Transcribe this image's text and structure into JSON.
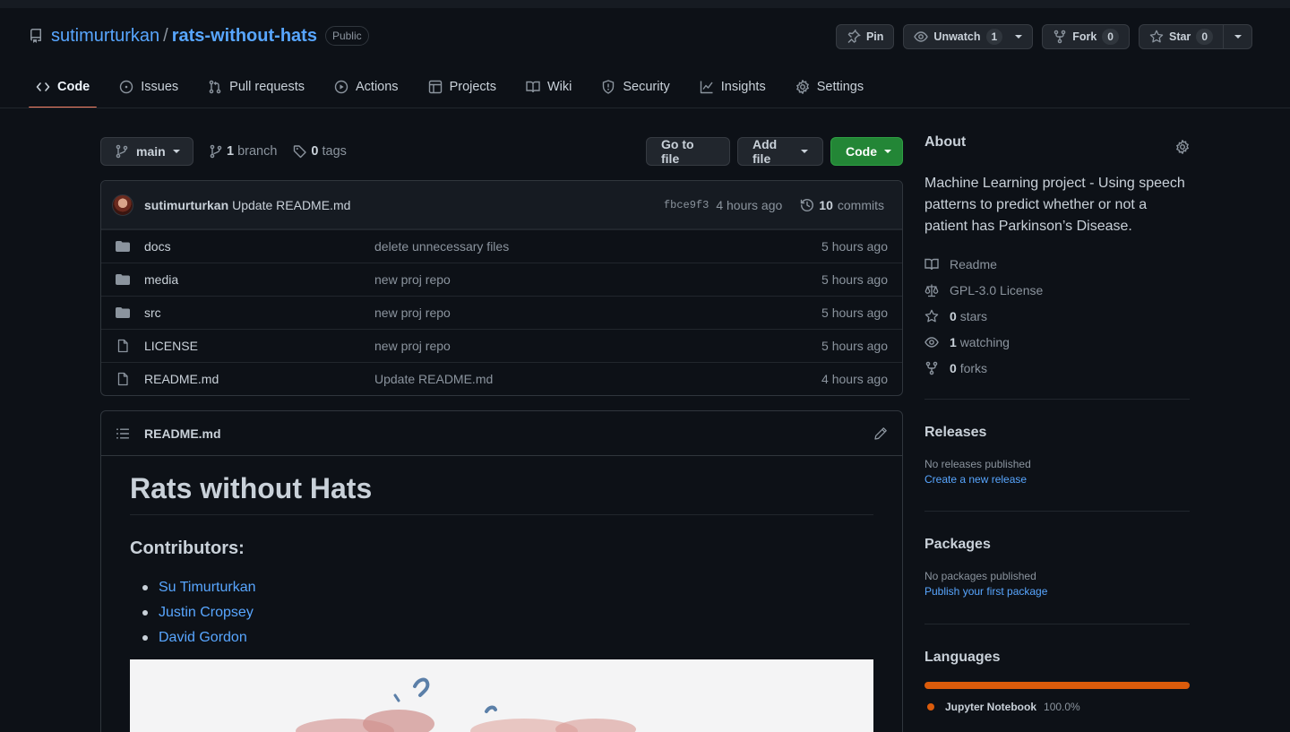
{
  "repo": {
    "owner": "sutimurturkan",
    "separator": "/",
    "name": "rats-without-hats",
    "visibility": "Public"
  },
  "actions": {
    "pin": "Pin",
    "unwatch": "Unwatch",
    "unwatch_count": "1",
    "fork": "Fork",
    "fork_count": "0",
    "star": "Star",
    "star_count": "0"
  },
  "tabs": [
    {
      "label": "Code",
      "icon": "code-icon"
    },
    {
      "label": "Issues",
      "icon": "issue-icon"
    },
    {
      "label": "Pull requests",
      "icon": "pull-request-icon"
    },
    {
      "label": "Actions",
      "icon": "play-icon"
    },
    {
      "label": "Projects",
      "icon": "table-icon"
    },
    {
      "label": "Wiki",
      "icon": "book-icon"
    },
    {
      "label": "Security",
      "icon": "shield-icon"
    },
    {
      "label": "Insights",
      "icon": "graph-icon"
    },
    {
      "label": "Settings",
      "icon": "gear-icon"
    }
  ],
  "toolbar": {
    "branch": "main",
    "branch_count": "1",
    "branch_label": "branch",
    "tag_count": "0",
    "tag_label": "tags",
    "go_to_file": "Go to file",
    "add_file": "Add file",
    "code": "Code"
  },
  "latest_commit": {
    "author": "sutimurturkan",
    "message": "Update README.md",
    "sha": "fbce9f3",
    "age": "4 hours ago",
    "commit_count": "10",
    "commit_label": "commits"
  },
  "files": [
    {
      "type": "folder",
      "name": "docs",
      "message": "delete unnecessary files",
      "age": "5 hours ago"
    },
    {
      "type": "folder",
      "name": "media",
      "message": "new proj repo",
      "age": "5 hours ago"
    },
    {
      "type": "folder",
      "name": "src",
      "message": "new proj repo",
      "age": "5 hours ago"
    },
    {
      "type": "file",
      "name": "LICENSE",
      "message": "new proj repo",
      "age": "5 hours ago"
    },
    {
      "type": "file",
      "name": "README.md",
      "message": "Update README.md",
      "age": "4 hours ago"
    }
  ],
  "readme": {
    "filename": "README.md",
    "title": "Rats without Hats",
    "contributors_heading": "Contributors:",
    "contributors": [
      "Su Timurturkan",
      "Justin Cropsey",
      "David Gordon"
    ]
  },
  "about": {
    "heading": "About",
    "description": "Machine Learning project - Using speech patterns to predict whether or not a patient has Parkinson’s Disease.",
    "readme": "Readme",
    "license": "GPL-3.0 License",
    "stars_count": "0",
    "stars_label": "stars",
    "watching_count": "1",
    "watching_label": "watching",
    "forks_count": "0",
    "forks_label": "forks"
  },
  "releases": {
    "heading": "Releases",
    "empty": "No releases published",
    "link": "Create a new release"
  },
  "packages": {
    "heading": "Packages",
    "empty": "No packages published",
    "link": "Publish your first package"
  },
  "languages": {
    "heading": "Languages",
    "items": [
      {
        "name": "Jupyter Notebook",
        "percent": "100.0%",
        "color": "#da5b0b"
      }
    ]
  },
  "colors": {
    "accent": "#58a6ff",
    "primary_button": "#238636",
    "tab_underline": "#f78166"
  }
}
